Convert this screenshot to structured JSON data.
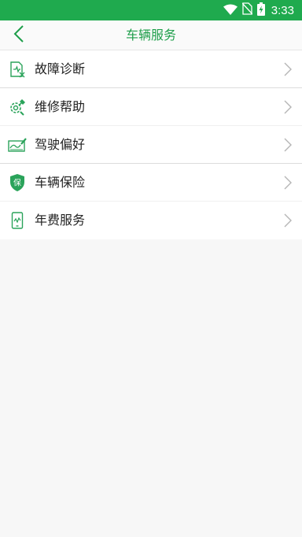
{
  "status_bar": {
    "time": "3:33",
    "icons": [
      "wifi-icon",
      "no-sim-icon",
      "battery-charging-icon"
    ]
  },
  "header": {
    "title": "车辆服务",
    "back_icon": "back-arrow-icon"
  },
  "menu": {
    "items": [
      {
        "label": "故障诊断",
        "icon": "diagnosis-report-icon"
      },
      {
        "label": "维修帮助",
        "icon": "repair-gear-icon"
      },
      {
        "label": "驾驶偏好",
        "icon": "driving-preference-icon"
      },
      {
        "label": "车辆保险",
        "icon": "insurance-shield-icon",
        "icon_text": "保"
      },
      {
        "label": "年费服务",
        "icon": "annual-fee-phone-icon"
      }
    ]
  },
  "colors": {
    "status_bar": "#1faa4e",
    "accent": "#1e9e4a",
    "icon": "#2aa35a",
    "chevron": "#b5b5b5",
    "background": "#f7f7f7"
  }
}
